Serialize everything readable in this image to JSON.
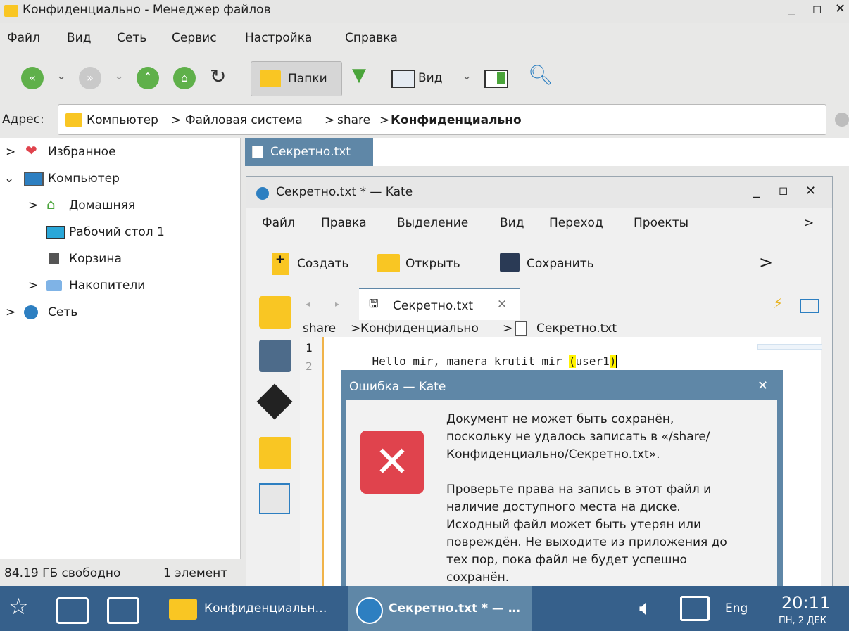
{
  "window": {
    "title": "Конфиденциально - Менеджер файлов",
    "menu": [
      "Файл",
      "Вид",
      "Сеть",
      "Сервис",
      "Настройка",
      "Справка"
    ],
    "folders_button": "Папки",
    "view_button": "Вид",
    "address_label": "Адрес:",
    "breadcrumb": [
      "Компьютер",
      "Файловая система",
      "share",
      "Конфиденциально"
    ]
  },
  "tree": {
    "items": [
      "Избранное",
      "Компьютер",
      "Домашняя",
      "Рабочий стол 1",
      "Корзина",
      "Накопители",
      "Сеть"
    ]
  },
  "file_tab": "Секретно.txt",
  "status": {
    "free": "84.19 ГБ свободно",
    "count": "1 элемент"
  },
  "kate": {
    "title": "Секретно.txt * — Kate",
    "menu": [
      "Файл",
      "Правка",
      "Выделение",
      "Вид",
      "Переход",
      "Проекты"
    ],
    "toolbar": {
      "create": "Создать",
      "open": "Открыть",
      "save": "Сохранить"
    },
    "doc_tab": "Секретно.txt",
    "path": [
      "share",
      "Конфиденциально",
      "Секретно.txt"
    ],
    "lines": [
      "1",
      "2"
    ],
    "code": {
      "pre": "Hello mir, manera krutit mir ",
      "open_paren": "(",
      "mid": "user1",
      "close_paren": ")"
    }
  },
  "dialog": {
    "title": "Ошибка — Kate",
    "message1": [
      "Документ не может быть сохранён,",
      "поскольку не удалось записать в «/share/",
      "Конфиденциально/Секретно.txt»."
    ],
    "message2": [
      "Проверьте права на запись в этот файл и",
      "наличие доступного места на диске.",
      "Исходный файл может быть утерян или",
      "повреждён. Не выходите из приложения до",
      "тех пор, пока файл не будет успешно",
      "сохранён."
    ]
  },
  "taskbar": {
    "task1": "Конфиденциальн…",
    "task2": "Секретно.txt * — …",
    "lang": "Eng",
    "time": "20:11",
    "date": "ПН, 2 ДЕК"
  },
  "colors": {
    "taskbar": "#36608b",
    "dialog_frame": "#5f87a7",
    "error_red": "#e0434d",
    "highlight": "#fff200"
  }
}
